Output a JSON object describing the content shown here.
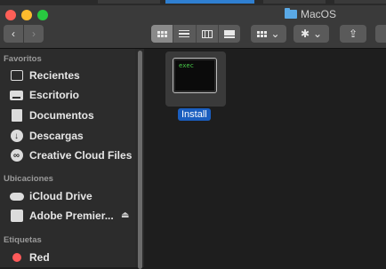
{
  "window": {
    "title": "MacOS"
  },
  "toolbar": {
    "back_symbol": "‹",
    "forward_symbol": "›",
    "action_symbol": "✱",
    "dropdown_symbol": "⌄",
    "share_symbol": "⇪"
  },
  "sidebar": {
    "sections": [
      {
        "title": "Favoritos",
        "items": [
          {
            "label": "Recientes",
            "icon": "recents-icon"
          },
          {
            "label": "Escritorio",
            "icon": "desktop-icon"
          },
          {
            "label": "Documentos",
            "icon": "documents-icon"
          },
          {
            "label": "Descargas",
            "icon": "downloads-icon"
          },
          {
            "label": "Creative Cloud Files",
            "icon": "creative-cloud-icon"
          }
        ]
      },
      {
        "title": "Ubicaciones",
        "items": [
          {
            "label": "iCloud Drive",
            "icon": "icloud-icon"
          },
          {
            "label": "Adobe Premier...",
            "icon": "drive-icon",
            "eject": "⏏"
          }
        ]
      },
      {
        "title": "Etiquetas",
        "items": [
          {
            "label": "Red",
            "icon": "tag-red-icon",
            "color": "#ff5a5a"
          }
        ]
      }
    ]
  },
  "main": {
    "files": [
      {
        "name": "Install",
        "icon_text": "exec",
        "selected": true
      }
    ]
  }
}
